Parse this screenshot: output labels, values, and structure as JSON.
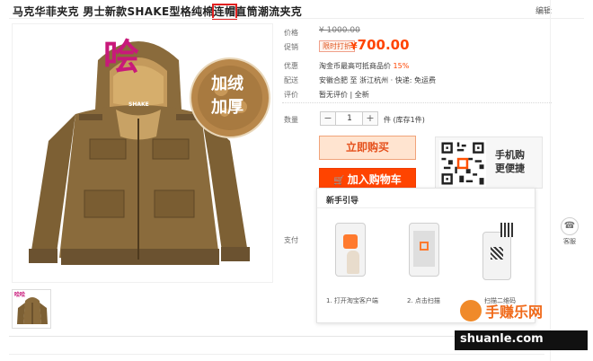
{
  "product": {
    "title_before": "马克华菲夹克 男士新款SHAKE型格纯棉",
    "title_highlight": "连帽",
    "title_after": "直筒潮流夹克",
    "edit_label": "编辑"
  },
  "photo": {
    "stamp_text": "哙",
    "fleece_label_line1": "加绒",
    "fleece_label_line2": "加厚",
    "collar_tag": "SHAKE"
  },
  "thumbnail": {
    "corner_text": "哙哙"
  },
  "labels": {
    "price": "价格",
    "promo": "促销",
    "benefit": "优惠",
    "shipping": "配送",
    "rating": "评价",
    "quantity": "数量",
    "payment": "支付"
  },
  "values": {
    "old_price": "¥ 1000.00",
    "promo_tag": "限时打折",
    "currency": "¥",
    "price": "700.00",
    "benefit_text": "淘金币最高可抵商品价",
    "benefit_percent": "15%",
    "shipping_text": "安徽合肥 至 浙江杭州 ·  快递: 免运费",
    "rating_text": "暂无评价 | 全新",
    "qty_value": "1",
    "qty_unit": "件 (库存1件)",
    "qty_minus": "−",
    "qty_plus": "+"
  },
  "buttons": {
    "buy_now": "立即购买",
    "add_to_cart": "加入购物车",
    "cart_icon": "cart-icon"
  },
  "mobile": {
    "line1": "手机购",
    "line2": "更便捷"
  },
  "guide": {
    "title": "新手引导",
    "step1": "1. 打开淘宝客户端",
    "step2": "2. 点击扫描",
    "step3": "扫描二维码"
  },
  "side": {
    "service_label": "客服",
    "service_icon": "headset-icon"
  },
  "watermark": {
    "line1": "手赚乐网",
    "line2": "shuanle.com"
  },
  "colors": {
    "price_orange": "#ff4400",
    "highlight_red": "#e02020",
    "stamp_magenta": "#c8197a",
    "jacket_khaki": "#8a6b3c"
  }
}
